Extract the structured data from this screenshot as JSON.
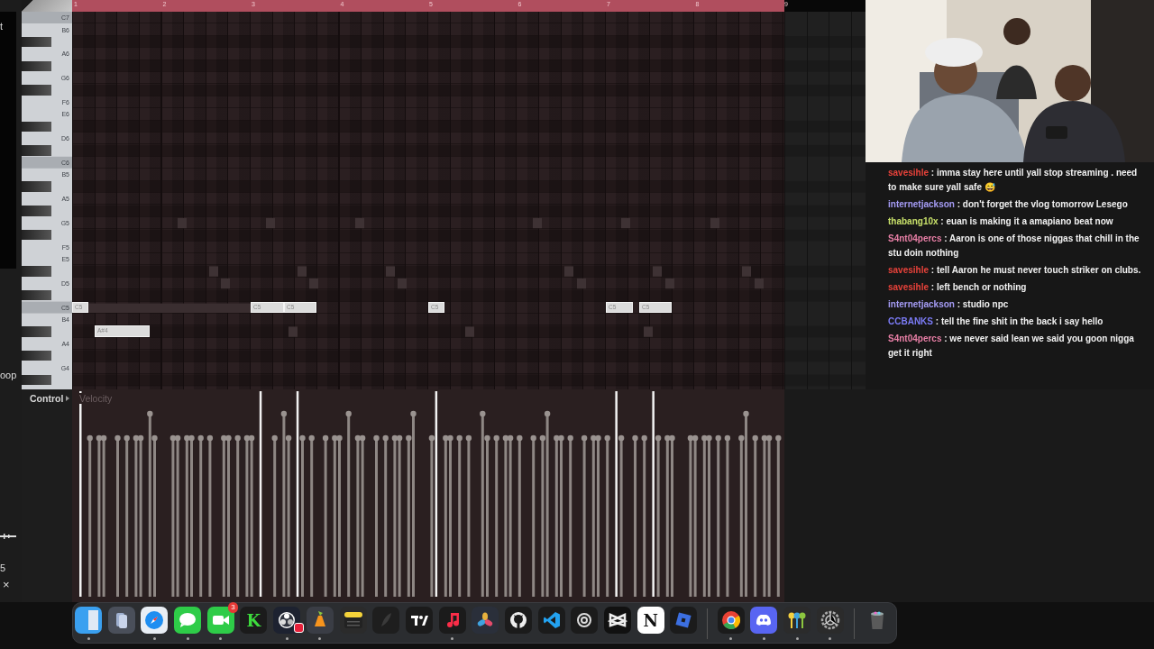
{
  "sidebar": {
    "labels": [
      "t",
      "oop",
      "5"
    ],
    "close": "×"
  },
  "ruler": {
    "bars": [
      "1",
      "2",
      "3",
      "4",
      "5",
      "6",
      "7",
      "8",
      "9"
    ]
  },
  "keyboard": {
    "keys": [
      "C7",
      "B6",
      "A6",
      "G6",
      "F6",
      "E6",
      "D6",
      "C6",
      "B5",
      "A5",
      "G5",
      "F5",
      "E5",
      "D5",
      "C5",
      "B4",
      "A4",
      "G4"
    ]
  },
  "notes": [
    {
      "label": "C5"
    },
    {
      "label": "A#4"
    },
    {
      "label": "C5"
    },
    {
      "label": "C5"
    },
    {
      "label": "C5"
    },
    {
      "label": "C5"
    },
    {
      "label": "C5"
    }
  ],
  "control": {
    "label": "Control",
    "parameter": "Velocity"
  },
  "chat": [
    {
      "user": "savesihle",
      "color": "#e8423a",
      "text": ": imma stay here until yall stop streaming . need to make sure yall safe 😅"
    },
    {
      "user": "internetjackson",
      "color": "#a59cf5",
      "text": ": don't forget the vlog tomorrow Lesego"
    },
    {
      "user": "thabang10x",
      "color": "#c8e06a",
      "text": ": euan is making it a amapiano beat now"
    },
    {
      "user": "S4nt04percs",
      "color": "#e87fa6",
      "text": ": Aaron is one of those niggas that chill in the stu doin nothing"
    },
    {
      "user": "savesihle",
      "color": "#e8423a",
      "text": ": tell Aaron he must never touch striker on clubs."
    },
    {
      "user": "savesihle",
      "color": "#e8423a",
      "text": ": left bench or nothing"
    },
    {
      "user": "internetjackson",
      "color": "#a59cf5",
      "text": ": studio npc"
    },
    {
      "user": "CCBANKS",
      "color": "#7b7bf5",
      "text": ": tell the fine shit in the back i say hello"
    },
    {
      "user": "S4nt04percs",
      "color": "#e87fa6",
      "text": ": we never said lean we said you goon nigga get it right"
    }
  ],
  "dock": [
    {
      "kind": "finder",
      "running": true
    },
    {
      "kind": "files"
    },
    {
      "kind": "safari",
      "running": true
    },
    {
      "kind": "messages",
      "running": true
    },
    {
      "kind": "facetime",
      "running": true,
      "badge": "3"
    },
    {
      "kind": "letter",
      "glyph": "K"
    },
    {
      "kind": "obs",
      "running": true,
      "recording": true
    },
    {
      "kind": "fl",
      "running": true
    },
    {
      "kind": "notes"
    },
    {
      "kind": "feather"
    },
    {
      "kind": "tradingview"
    },
    {
      "kind": "music",
      "running": true
    },
    {
      "kind": "davinci"
    },
    {
      "kind": "github"
    },
    {
      "kind": "vscode"
    },
    {
      "kind": "knot"
    },
    {
      "kind": "capcut"
    },
    {
      "kind": "notion",
      "glyph": "N"
    },
    {
      "kind": "roblox"
    },
    {
      "kind": "separator"
    },
    {
      "kind": "chrome",
      "running": true
    },
    {
      "kind": "discord",
      "running": true
    },
    {
      "kind": "keys",
      "running": true
    },
    {
      "kind": "settings",
      "running": true
    },
    {
      "kind": "separator"
    },
    {
      "kind": "trash"
    }
  ]
}
